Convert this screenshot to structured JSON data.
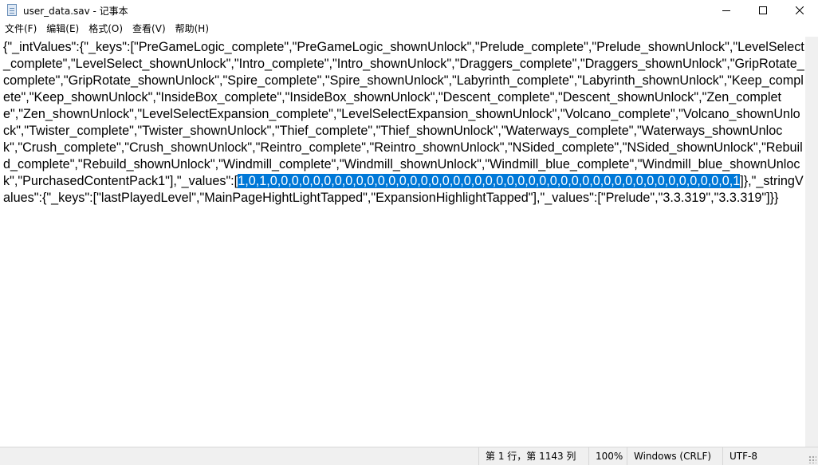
{
  "window": {
    "title": "user_data.sav - 记事本",
    "app_icon": "notepad-icon",
    "controls": [
      "minimize-icon",
      "maximize-icon",
      "close-icon"
    ]
  },
  "menu": {
    "items": [
      {
        "label": "文件(F)"
      },
      {
        "label": "编辑(E)"
      },
      {
        "label": "格式(O)"
      },
      {
        "label": "查看(V)"
      },
      {
        "label": "帮助(H)"
      }
    ]
  },
  "editor": {
    "text_before_selection": "{\"_intValues\":{\"_keys\":[\"PreGameLogic_complete\",\"PreGameLogic_shownUnlock\",\"Prelude_complete\",\"Prelude_shownUnlock\",\"LevelSelect_complete\",\"LevelSelect_shownUnlock\",\"Intro_complete\",\"Intro_shownUnlock\",\"Draggers_complete\",\"Draggers_shownUnlock\",\"GripRotate_complete\",\"GripRotate_shownUnlock\",\"Spire_complete\",\"Spire_shownUnlock\",\"Labyrinth_complete\",\"Labyrinth_shownUnlock\",\"Keep_complete\",\"Keep_shownUnlock\",\"InsideBox_complete\",\"InsideBox_shownUnlock\",\"Descent_complete\",\"Descent_shownUnlock\",\"Zen_complete\",\"Zen_shownUnlock\",\"LevelSelectExpansion_complete\",\"LevelSelectExpansion_shownUnlock\",\"Volcano_complete\",\"Volcano_shownUnlock\",\"Twister_complete\",\"Twister_shownUnlock\",\"Thief_complete\",\"Thief_shownUnlock\",\"Waterways_complete\",\"Waterways_shownUnlock\",\"Crush_complete\",\"Crush_shownUnlock\",\"Reintro_complete\",\"Reintro_shownUnlock\",\"NSided_complete\",\"NSided_shownUnlock\",\"Rebuild_complete\",\"Rebuild_shownUnlock\",\"Windmill_complete\",\"Windmill_shownUnlock\",\"Windmill_blue_complete\",\"Windmill_blue_shownUnlock\",\"PurchasedContentPack1\"],\"_values\":[",
    "selected_text": "1,0,1,0,0,0,0,0,0,0,0,0,0,0,0,0,0,0,0,0,0,0,0,0,0,0,0,0,0,0,0,0,0,0,0,0,0,0,0,0,0,0,0,0,0,0,1",
    "text_after_selection": "]},\"_stringValues\":{\"_keys\":[\"lastPlayedLevel\",\"MainPageHightLightTapped\",\"ExpansionHighlightTapped\"],\"_values\":[\"Prelude\",\"3.3.319\",\"3.3.319\"]}}"
  },
  "status": {
    "position": "第 1 行，第 1143 列",
    "zoom": "100%",
    "line_ending": "Windows (CRLF)",
    "encoding": "UTF-8"
  },
  "colors": {
    "selection": "#0078d7",
    "statusbar": "#f0f0f0"
  }
}
